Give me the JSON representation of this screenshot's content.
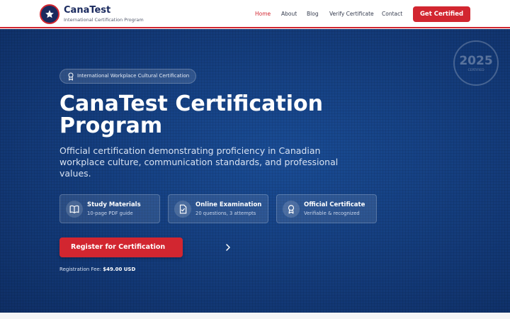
{
  "brand": {
    "name": "CanaTest",
    "tagline": "International Certification Program"
  },
  "nav": {
    "items": [
      {
        "label": "Home",
        "active": true
      },
      {
        "label": "About"
      },
      {
        "label": "Blog"
      },
      {
        "label": "Verify Certificate"
      },
      {
        "label": "Contact"
      }
    ],
    "cta_label": "Get Certified"
  },
  "hero": {
    "badge_text": "International Workplace Cultural Certification",
    "title_line1": "CanaTest Certification",
    "title_line2": "Program",
    "subtitle": "Official certification demonstrating proficiency in Canadian workplace culture, communication standards, and professional values.",
    "year": "2025",
    "year_caption": "CERTIFIED",
    "features": [
      {
        "icon": "book-icon",
        "title": "Study Materials",
        "subtitle": "10-page PDF guide"
      },
      {
        "icon": "document-check-icon",
        "title": "Online Examination",
        "subtitle": "20 questions, 3 attempts"
      },
      {
        "icon": "award-icon",
        "title": "Official Certificate",
        "subtitle": "Verifiable & recognized"
      }
    ],
    "register_label": "Register for Certification",
    "fee_label": "Registration Fee:",
    "fee_value": "$49.00 USD"
  },
  "colors": {
    "primary": "#1a2a5e",
    "accent": "#d22630",
    "hero_bg": "#153f80"
  }
}
